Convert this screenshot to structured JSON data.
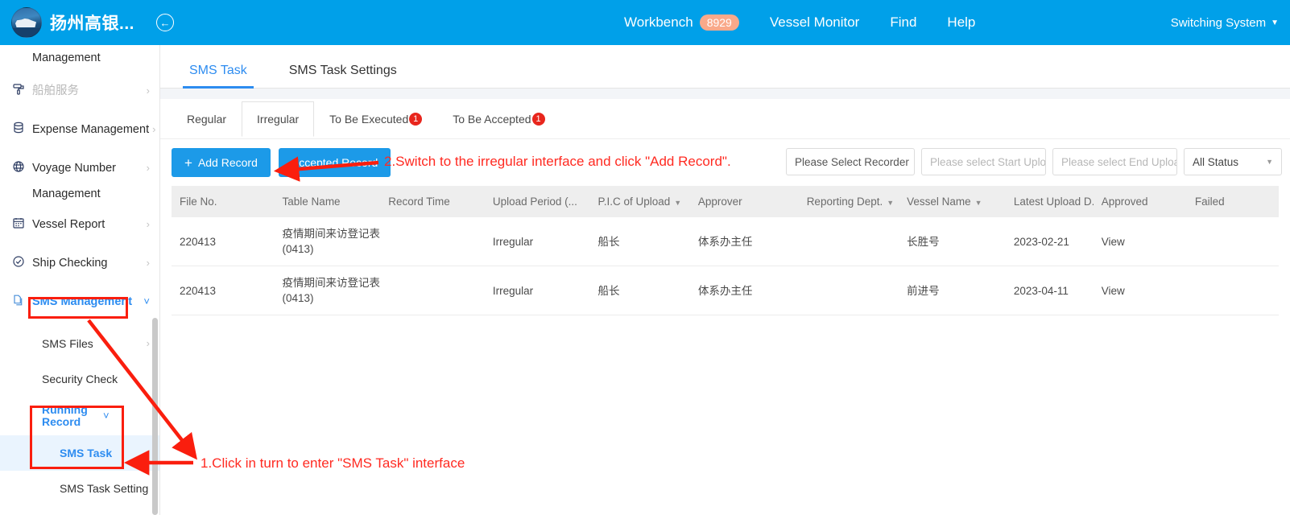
{
  "topbar": {
    "logo_icon": "ship-logo-icon",
    "brand_title": "扬州高银...",
    "back_icon": "back-arrow-circle-icon",
    "nav": [
      {
        "label": "Workbench",
        "badge": "8929"
      },
      {
        "label": "Vessel Monitor",
        "badge": ""
      },
      {
        "label": "Find",
        "badge": ""
      },
      {
        "label": "Help",
        "badge": ""
      }
    ],
    "switch_system": "Switching System",
    "switch_caret_icon": "caret-down-icon"
  },
  "sidebar": {
    "partial_top_label": "Management",
    "items": [
      {
        "label": "船舶服务",
        "icon": "paint-roller-icon",
        "arrow": "chevron-right-icon",
        "dim": true
      },
      {
        "label": "Expense Management",
        "icon": "database-icon",
        "arrow": "chevron-right-icon",
        "dim": false
      },
      {
        "label": "Voyage Number",
        "label2": "Management",
        "icon": "globe-icon",
        "arrow": "chevron-right-icon",
        "dim": false
      },
      {
        "label": "Vessel Report",
        "icon": "calendar-icon",
        "arrow": "chevron-right-icon",
        "dim": false
      },
      {
        "label": "Ship Checking",
        "icon": "check-circle-icon",
        "arrow": "chevron-right-icon",
        "dim": false
      },
      {
        "label": "SMS Management",
        "icon": "documents-icon",
        "arrow": "chevron-down-icon",
        "dim": false
      }
    ],
    "sub_items": [
      {
        "label": "SMS Files",
        "arrow": "chevron-right-icon"
      },
      {
        "label": "Security Check",
        "arrow": ""
      },
      {
        "label": "Running Record",
        "arrow": "chevron-down-icon"
      },
      {
        "label": "SMS Task",
        "arrow": ""
      },
      {
        "label": "SMS Task Setting",
        "arrow": ""
      }
    ]
  },
  "main": {
    "tabs": [
      {
        "label": "SMS Task",
        "active": true
      },
      {
        "label": "SMS Task Settings",
        "active": false
      }
    ],
    "subtabs": [
      {
        "label": "Regular",
        "badge": "",
        "active": false
      },
      {
        "label": "Irregular",
        "badge": "",
        "active": true
      },
      {
        "label": "To Be Executed",
        "badge": "1",
        "active": false
      },
      {
        "label": "To Be Accepted",
        "badge": "1",
        "active": false
      }
    ],
    "toolbar": {
      "add_record_label": "Add Record",
      "add_record_plus": "+",
      "accepted_record_label": "Accepted Record"
    },
    "filters": {
      "recorder_value": "Please Select Recorder",
      "start_upload_placeholder": "Please select Start Upload",
      "end_upload_placeholder": "Please select End Upload",
      "status_value": "All Status"
    },
    "table": {
      "columns": [
        {
          "label": "File No.",
          "sortable": false
        },
        {
          "label": "Table Name",
          "sortable": false
        },
        {
          "label": "Record Time",
          "sortable": false
        },
        {
          "label": "Upload Period (...",
          "sortable": false
        },
        {
          "label": "P.I.C of Upload",
          "sortable": true
        },
        {
          "label": "Approver",
          "sortable": false
        },
        {
          "label": "Reporting Dept.",
          "sortable": true
        },
        {
          "label": "Vessel Name",
          "sortable": true
        },
        {
          "label": "Latest Upload D...",
          "sortable": false
        },
        {
          "label": "Approved",
          "sortable": false
        },
        {
          "label": "Failed",
          "sortable": false
        }
      ],
      "rows": [
        {
          "file_no": "220413",
          "table_name": "疫情期间来访登记表 (0413)",
          "record_time": "",
          "upload_period": "Irregular",
          "pic_of_upload": "船长",
          "approver": "体系办主任",
          "reporting_dept": "",
          "vessel_name": "长胜号",
          "latest_upload_date": "2023-02-21",
          "approved": "View",
          "failed": ""
        },
        {
          "file_no": "220413",
          "table_name": "疫情期间来访登记表 (0413)",
          "record_time": "",
          "upload_period": "Irregular",
          "pic_of_upload": "船长",
          "approver": "体系办主任",
          "reporting_dept": "",
          "vessel_name": "前进号",
          "latest_upload_date": "2023-04-11",
          "approved": "View",
          "failed": ""
        }
      ]
    }
  },
  "annotations": {
    "step1": "1.Click in turn to enter \"SMS Task\" interface",
    "step2": "2.Switch to the irregular interface and click \"Add Record\".",
    "accent_color": "#ff2a21"
  }
}
